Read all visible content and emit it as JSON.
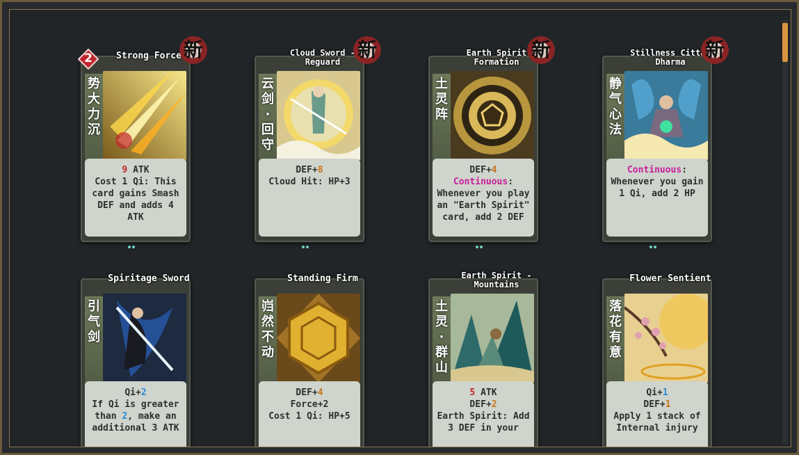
{
  "cards": [
    {
      "title": "Strong Force",
      "cn": "势大力沉",
      "cost": "2",
      "is_new": true,
      "new_label": "新",
      "art_theme": "golden-slash",
      "lines": [
        [
          {
            "t": "9",
            "c": "red"
          },
          {
            "t": " ATK",
            "c": ""
          }
        ],
        [
          {
            "t": "Cost 1 Qi: This",
            "c": ""
          }
        ],
        [
          {
            "t": "card gains Smash",
            "c": ""
          }
        ],
        [
          {
            "t": "DEF and adds 4",
            "c": ""
          }
        ],
        [
          {
            "t": "ATK",
            "c": ""
          }
        ]
      ]
    },
    {
      "title": "Cloud Sword -\nReguard",
      "cn": "云剑·回守",
      "is_new": true,
      "new_label": "新",
      "art_theme": "cloud-swordsman",
      "lines": [
        [
          {
            "t": "DEF+",
            "c": ""
          },
          {
            "t": "8",
            "c": "orange"
          }
        ],
        [
          {
            "t": "Cloud Hit: HP+3",
            "c": ""
          }
        ]
      ]
    },
    {
      "title": "Earth Spirit\nFormation",
      "cn": "土灵阵",
      "is_new": true,
      "new_label": "新",
      "art_theme": "golden-disc",
      "lines": [
        [
          {
            "t": "DEF+",
            "c": ""
          },
          {
            "t": "4",
            "c": "orange"
          }
        ],
        [
          {
            "t": "Continuous",
            "c": "magenta"
          },
          {
            "t": ":",
            "c": ""
          }
        ],
        [
          {
            "t": "Whenever you play",
            "c": ""
          }
        ],
        [
          {
            "t": "an \"Earth Spirit\"",
            "c": ""
          }
        ],
        [
          {
            "t": "card, add 2 DEF",
            "c": ""
          }
        ]
      ]
    },
    {
      "title": "Stillness Citta-\nDharma",
      "cn": "静气心法",
      "is_new": true,
      "new_label": "新",
      "art_theme": "meditation",
      "lines": [
        [
          {
            "t": "Continuous",
            "c": "magenta"
          },
          {
            "t": ":",
            "c": ""
          }
        ],
        [
          {
            "t": "Whenever you gain",
            "c": ""
          }
        ],
        [
          {
            "t": "1 Qi, add 2 HP",
            "c": ""
          }
        ]
      ]
    },
    {
      "title": "Spiritage Sword",
      "cn": "引气剑",
      "is_new": false,
      "art_theme": "blue-swordsman",
      "lines": [
        [
          {
            "t": "Qi+",
            "c": ""
          },
          {
            "t": "2",
            "c": "blue"
          }
        ],
        [
          {
            "t": "If Qi is greater",
            "c": ""
          }
        ],
        [
          {
            "t": "than ",
            "c": ""
          },
          {
            "t": "2",
            "c": "blue"
          },
          {
            "t": ", make an",
            "c": ""
          }
        ],
        [
          {
            "t": "additional 3 ATK",
            "c": ""
          }
        ]
      ]
    },
    {
      "title": "Standing Firm",
      "cn": "岿然不动",
      "is_new": false,
      "art_theme": "golden-shield",
      "lines": [
        [
          {
            "t": "DEF+",
            "c": ""
          },
          {
            "t": "4",
            "c": "orange"
          }
        ],
        [
          {
            "t": "Force+2",
            "c": ""
          }
        ],
        [
          {
            "t": "Cost 1 Qi: HP+5",
            "c": ""
          }
        ]
      ]
    },
    {
      "title": "Earth Spirit -\nMountains",
      "cn": "土灵·群山",
      "is_new": false,
      "art_theme": "mountains",
      "lines": [
        [
          {
            "t": "5",
            "c": "red"
          },
          {
            "t": " ATK",
            "c": ""
          }
        ],
        [
          {
            "t": "DEF+",
            "c": ""
          },
          {
            "t": "2",
            "c": "orange"
          }
        ],
        [
          {
            "t": "Earth Spirit: Add",
            "c": ""
          }
        ],
        [
          {
            "t": "3 DEF in your",
            "c": ""
          }
        ]
      ]
    },
    {
      "title": "Flower Sentient",
      "cn": "落花有意",
      "is_new": false,
      "art_theme": "blossom",
      "lines": [
        [
          {
            "t": "Qi+",
            "c": ""
          },
          {
            "t": "1",
            "c": "blue"
          }
        ],
        [
          {
            "t": "DEF+",
            "c": ""
          },
          {
            "t": "1",
            "c": "orange"
          }
        ],
        [
          {
            "t": "Apply 1 stack of",
            "c": ""
          }
        ],
        [
          {
            "t": "Internal injury",
            "c": ""
          }
        ]
      ]
    }
  ]
}
